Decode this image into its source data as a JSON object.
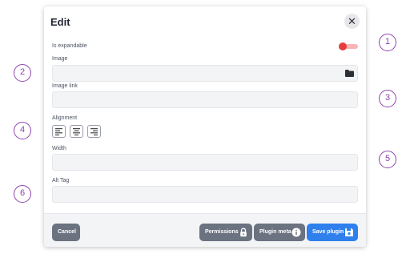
{
  "callouts": [
    "1",
    "2",
    "3",
    "4",
    "5",
    "6"
  ],
  "dialog": {
    "title": "Edit",
    "close_glyph": "✕",
    "fields": {
      "expandable_label": "Is expandable",
      "expandable_on": true,
      "image_label": "Image",
      "image_value": "",
      "image_link_label": "Image link",
      "image_link_value": "",
      "alignment_label": "Alignment",
      "alignment_options": [
        "left",
        "center",
        "right"
      ],
      "width_label": "Width",
      "width_value": "",
      "alt_tag_label": "Alt Tag",
      "alt_tag_value": ""
    },
    "footer": {
      "cancel": "Cancel",
      "permissions": "Permissions",
      "plugin_meta": "Plugin meta",
      "save_plugin": "Save plugin"
    }
  },
  "colors": {
    "callout": "#8e44ad",
    "toggle_on": "#e53d3f",
    "primary": "#2f80ed",
    "secondary": "#6b7280"
  },
  "icons": [
    "close-icon",
    "folder-icon",
    "align-left-icon",
    "align-center-icon",
    "align-right-icon",
    "lock-icon",
    "info-icon",
    "save-icon"
  ]
}
